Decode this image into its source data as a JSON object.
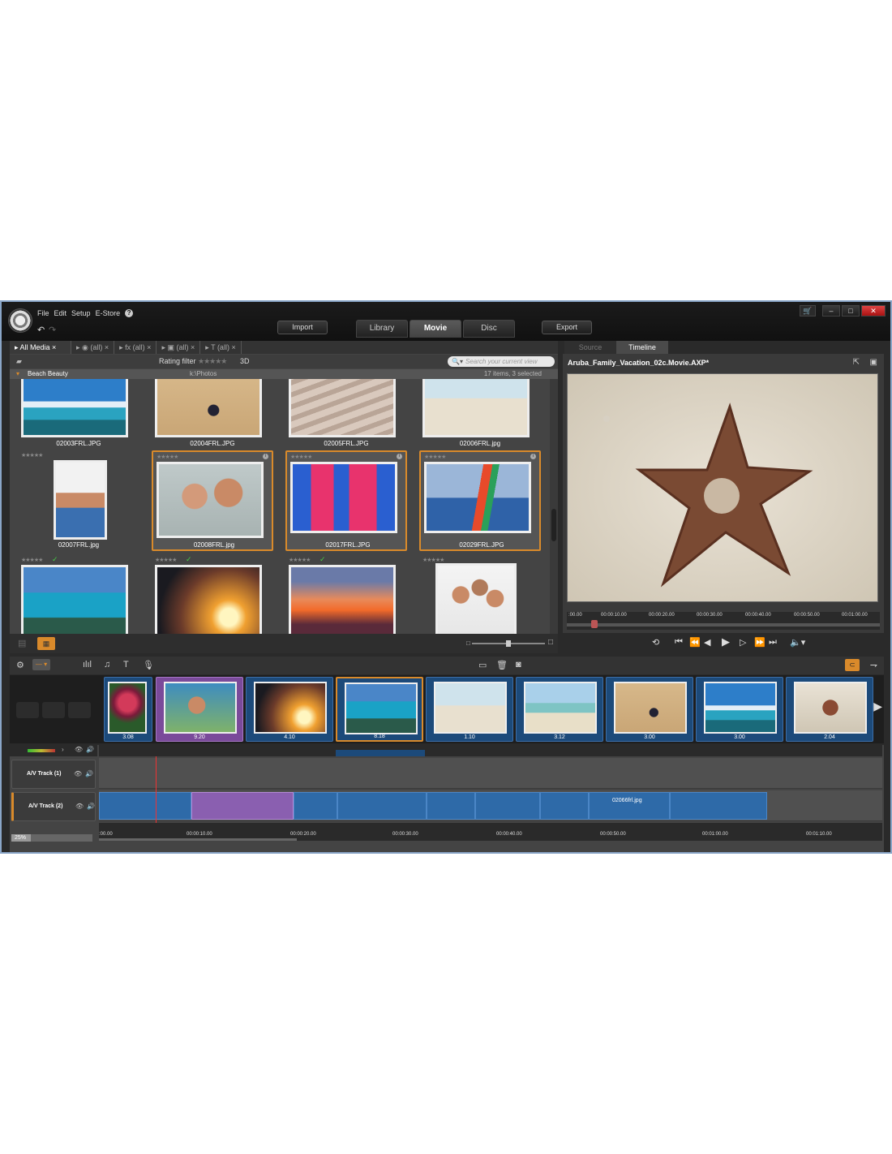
{
  "menu": {
    "file": "File",
    "edit": "Edit",
    "setup": "Setup",
    "estore": "E-Store",
    "help": "?"
  },
  "toolbar": {
    "import": "Import",
    "export": "Export"
  },
  "tabs": [
    {
      "label": "Library"
    },
    {
      "label": "Movie"
    },
    {
      "label": "Disc"
    }
  ],
  "library": {
    "tabs": {
      "all_media": "All Media",
      "t2": "(all)",
      "t3": "(all)",
      "t4": "(all)",
      "t5": "(all)"
    },
    "rating_filter": "Rating filter",
    "rating_stars": "★★★★★",
    "label_3d": "3D",
    "search_placeholder": "Search your current view",
    "collection": {
      "name": "Beach Beauty",
      "path": "k:\\Photos",
      "count": "17 items, 3 selected"
    },
    "items": [
      {
        "name": "02003FRL.JPG"
      },
      {
        "name": "02004FRL.JPG"
      },
      {
        "name": "02005FRL.JPG"
      },
      {
        "name": "02006FRL.jpg"
      },
      {
        "name": "02007FRL.jpg"
      },
      {
        "name": "02008FRL.jpg"
      },
      {
        "name": "02017FRL.JPG"
      },
      {
        "name": "02029FRL.JPG"
      }
    ],
    "star_text": "★★★★★",
    "check": "✓"
  },
  "preview": {
    "tab_source": "Source",
    "tab_timeline": "Timeline",
    "title": "Aruba_Family_Vacation_02c.Movie.AXP*",
    "ruler": [
      ":00.00",
      "00:00:10.00",
      "00:00:20.00",
      "00:00:30.00",
      "00:00:40.00",
      "00:00:50.00",
      "00:01:00.00"
    ]
  },
  "storyboard": {
    "durations": [
      "3.08",
      "9.20",
      "4.10",
      "8.18",
      "1.10",
      "3.12",
      "3.00",
      "3.00",
      "2.04"
    ]
  },
  "tracks": {
    "track1": "A/V Track (1)",
    "track2": "A/V Track (2)",
    "clip_label": "02066frl.jpg",
    "zoom": "25%",
    "ruler": [
      ":00.00",
      "00:00:10.00",
      "00:00:20.00",
      "00:00:30.00",
      "00:00:40.00",
      "00:00:50.00",
      "00:01:00.00",
      "00:01:10.00"
    ]
  },
  "colors": {
    "accent": "#d98a2b",
    "clip": "#2e6aa8",
    "close": "#cc3333"
  }
}
